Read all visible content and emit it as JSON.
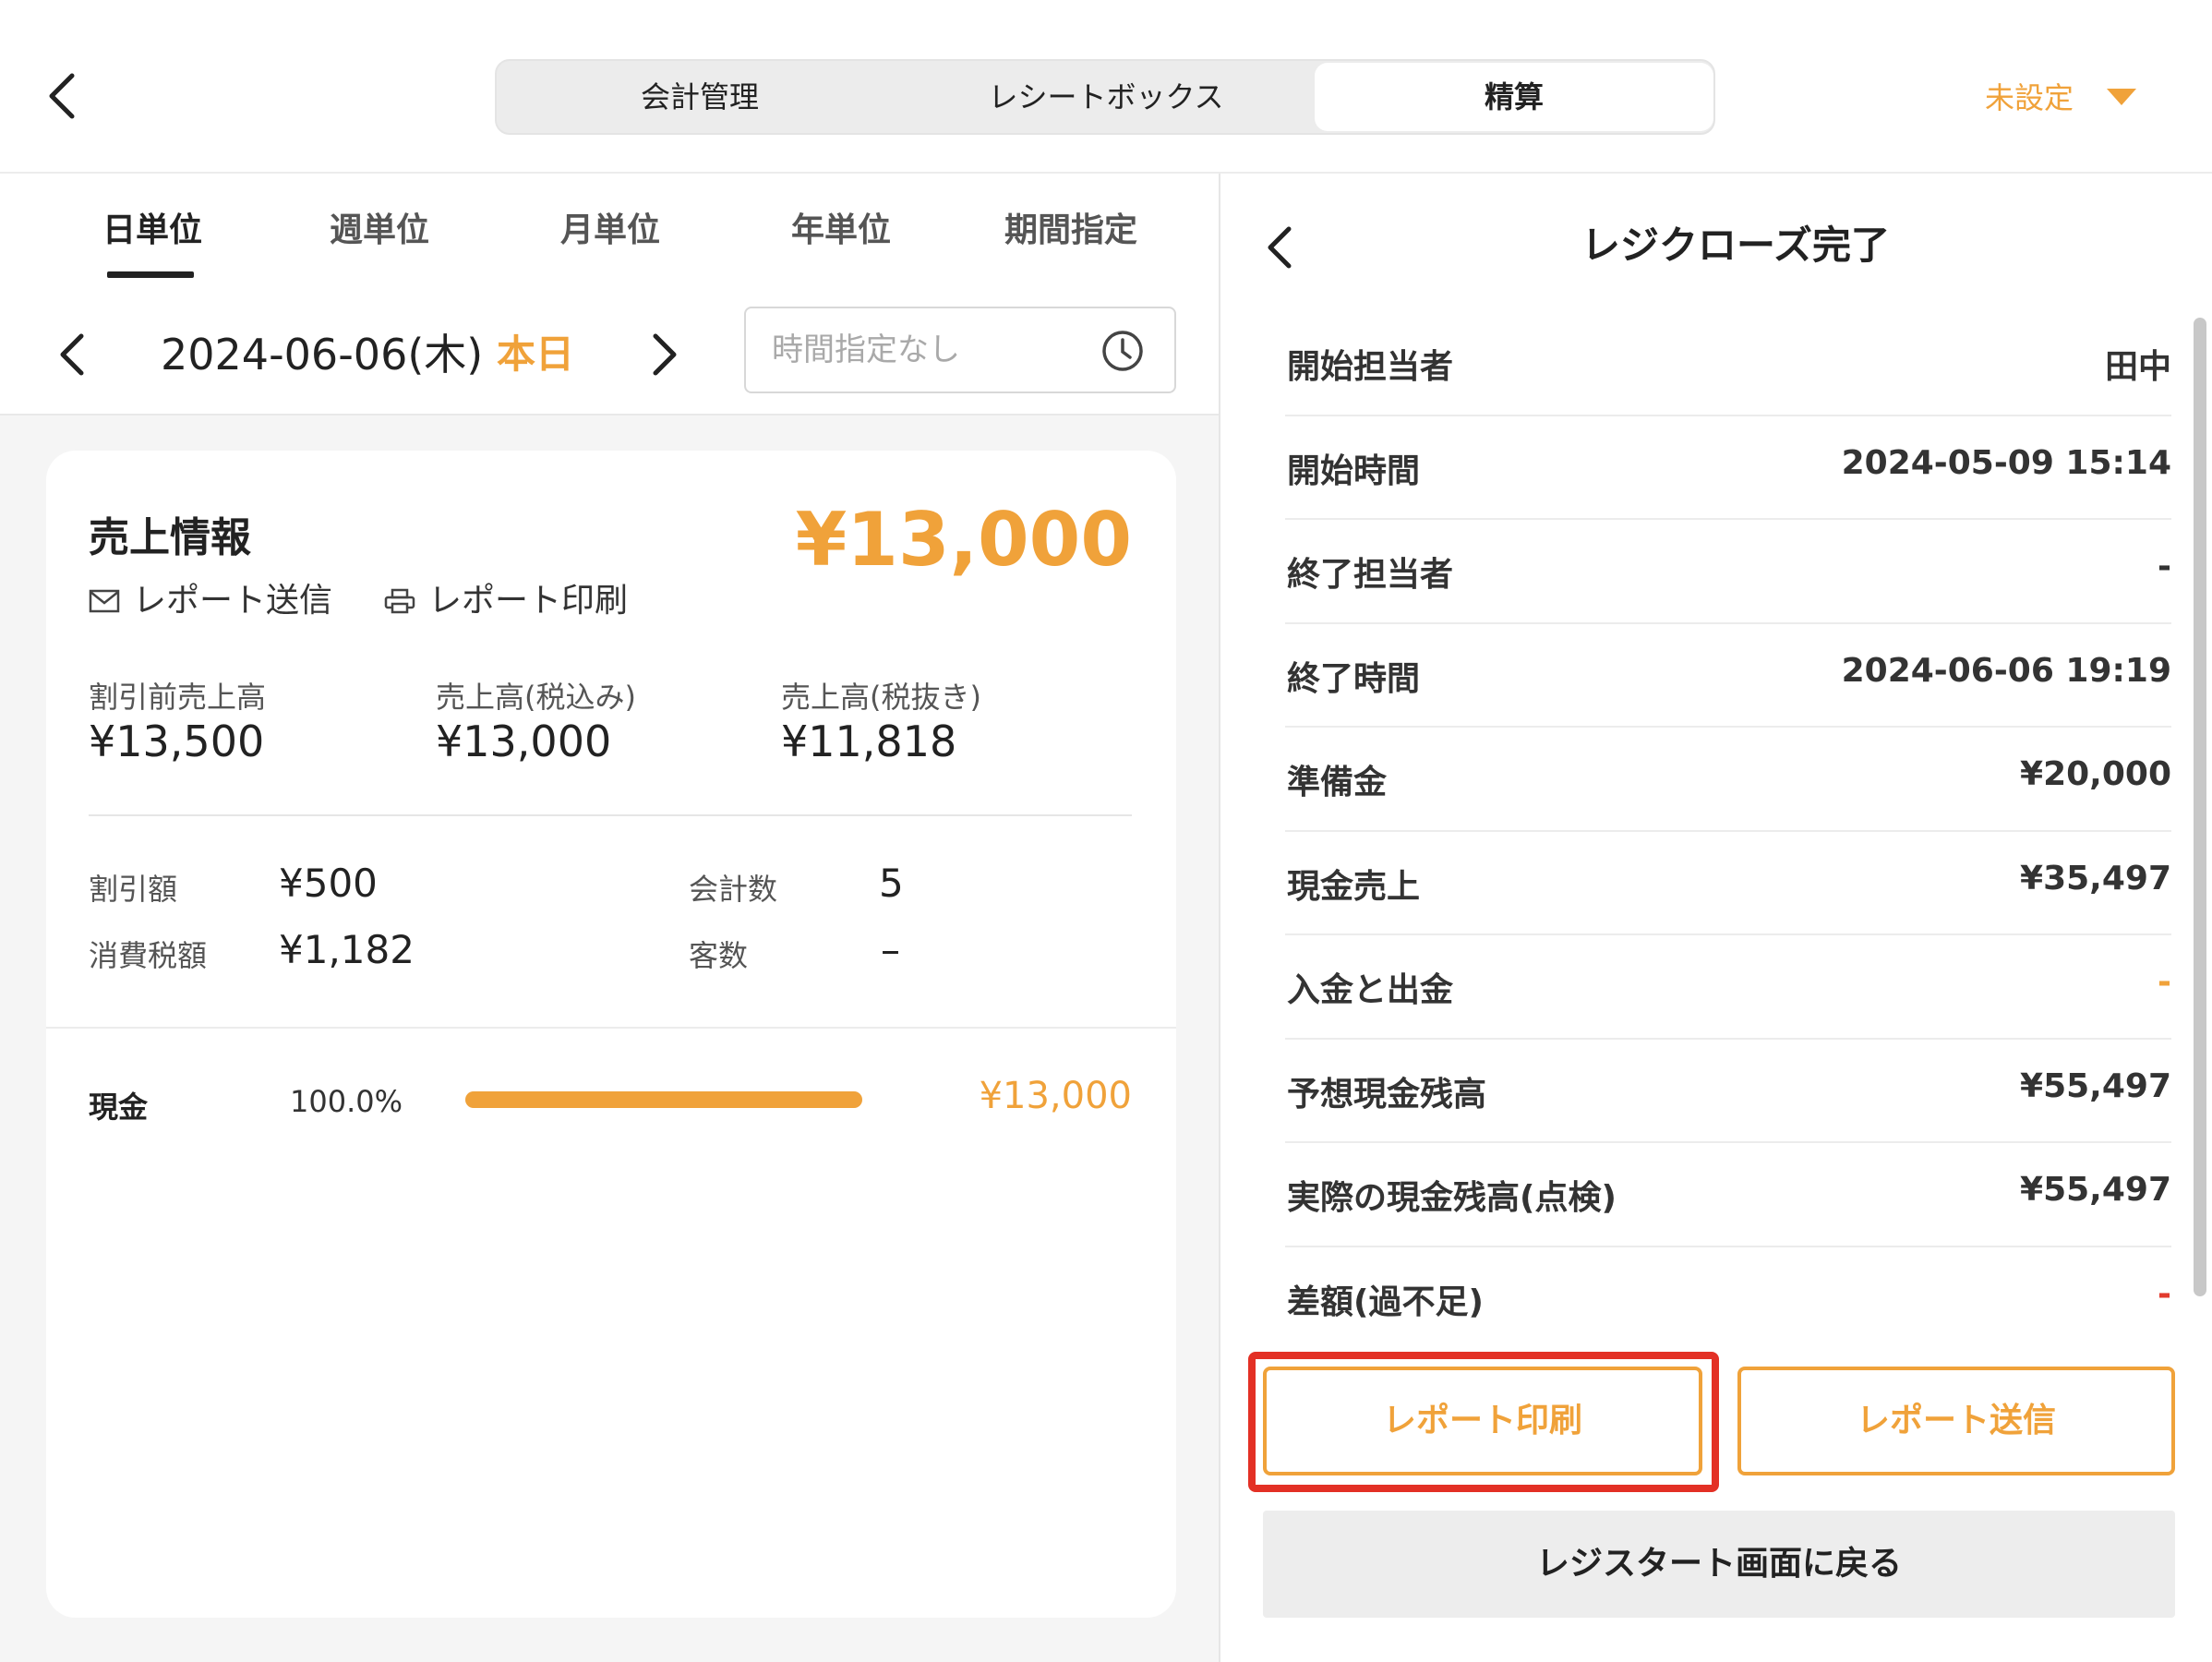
{
  "header": {
    "tabs": [
      {
        "label": "会計管理"
      },
      {
        "label": "レシートボックス"
      },
      {
        "label": "精算"
      }
    ],
    "store_selector": "未設定"
  },
  "period_tabs": [
    "日単位",
    "週単位",
    "月単位",
    "年単位",
    "期間指定"
  ],
  "date_nav": {
    "date": "2024-06-06(木)",
    "today_label": "本日",
    "time_placeholder": "時間指定なし"
  },
  "sales_card": {
    "title": "売上情報",
    "total": "¥13,000",
    "send_report": "レポート送信",
    "print_report": "レポート印刷",
    "stats": [
      {
        "label": "割引前売上高",
        "value": "¥13,500"
      },
      {
        "label": "売上高(税込み)",
        "value": "¥13,000"
      },
      {
        "label": "売上高(税抜き)",
        "value": "¥11,818"
      }
    ],
    "details": {
      "discount_label": "割引額",
      "discount_value": "¥500",
      "tax_label": "消費税額",
      "tax_value": "¥1,182",
      "count_label": "会計数",
      "count_value": "5",
      "customers_label": "客数",
      "customers_value": "–"
    },
    "payment": {
      "method": "現金",
      "percent_text": "100.0%",
      "percent": 100,
      "amount": "¥13,000"
    }
  },
  "close_panel": {
    "title": "レジクローズ完了",
    "rows": [
      {
        "label": "開始担当者",
        "value": "田中"
      },
      {
        "label": "開始時間",
        "value": "2024-05-09 15:14"
      },
      {
        "label": "終了担当者",
        "value": "-"
      },
      {
        "label": "終了時間",
        "value": "2024-06-06 19:19"
      },
      {
        "label": "準備金",
        "value": "¥20,000"
      },
      {
        "label": "現金売上",
        "value": "¥35,497"
      },
      {
        "label": "入金と出金",
        "value": "-"
      },
      {
        "label": "予想現金残高",
        "value": "¥55,497"
      },
      {
        "label": "実際の現金残高(点検)",
        "value": "¥55,497"
      },
      {
        "label": "差額(過不足)",
        "value": "-"
      }
    ],
    "print_button": "レポート印刷",
    "send_button": "レポート送信",
    "back_button": "レジスタート画面に戻る"
  },
  "colors": {
    "accent": "#f0a23a",
    "highlight": "#e33025",
    "negative": "#e23b2e"
  }
}
